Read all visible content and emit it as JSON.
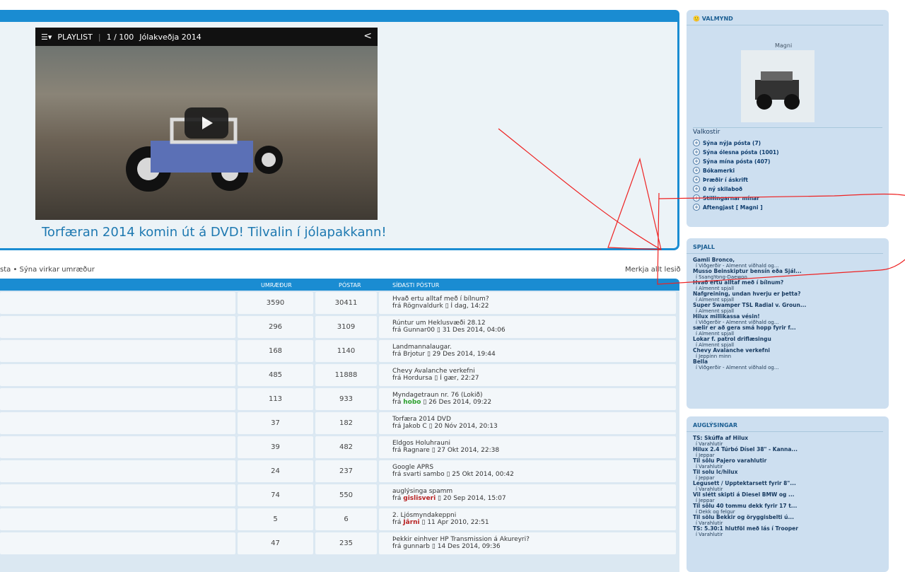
{
  "video": {
    "playlist_label": "PLAYLIST",
    "playlist_count": "1 / 100",
    "video_title": "Jólakveðja 2014",
    "caption": "Torfæran 2014 komin út á DVD! Tilvalin í jólapakkann!"
  },
  "crumbs": {
    "left": "sta • Sýna virkar umræður",
    "right": "Merkja allt lesið"
  },
  "forum": {
    "columns": [
      "UMRÆÐUR",
      "PÓSTAR",
      "SÍÐASTI PÓSTUR"
    ],
    "rows": [
      {
        "topics": "3590",
        "posts": "30411",
        "title": "Hvað ertu alltaf með í bílnum?",
        "by": "Rögnvaldurk",
        "date": "Í dag, 14:22",
        "color": ""
      },
      {
        "topics": "296",
        "posts": "3109",
        "title": "Rúntur um Heklusvæði 28.12",
        "by": "Gunnar00",
        "date": "31 Des 2014, 04:06",
        "color": ""
      },
      {
        "topics": "168",
        "posts": "1140",
        "title": "Landmannalaugar.",
        "by": "Brjotur",
        "date": "29 Des 2014, 19:44",
        "color": ""
      },
      {
        "topics": "485",
        "posts": "11888",
        "title": "Chevy Avalanche verkefni",
        "by": "Hordursa",
        "date": "Í gær, 22:27",
        "color": ""
      },
      {
        "topics": "113",
        "posts": "933",
        "title": "Myndagetraun nr. 76 (Lokið)",
        "by": "hobo",
        "date": "26 Des 2014, 09:22",
        "color": "green"
      },
      {
        "topics": "37",
        "posts": "182",
        "title": "Torfæra 2014 DVD",
        "by": "Jakob C",
        "date": "20 Nóv 2014, 20:13",
        "color": ""
      },
      {
        "topics": "39",
        "posts": "482",
        "title": "Eldgos Holuhrauni",
        "by": "Ragnare",
        "date": "27 Okt 2014, 22:38",
        "color": ""
      },
      {
        "topics": "24",
        "posts": "237",
        "title": "Google APRS",
        "by": "svarti sambo",
        "date": "25 Okt 2014, 00:42",
        "color": ""
      },
      {
        "topics": "74",
        "posts": "550",
        "title": "auglýsinga spamm",
        "by": "gislisveri",
        "date": "20 Sep 2014, 15:07",
        "color": "red"
      },
      {
        "topics": "5",
        "posts": "6",
        "title": "2. Ljósmyndakeppni",
        "by": "Jârni",
        "date": "11 Apr 2010, 22:51",
        "color": "red"
      },
      {
        "topics": "47",
        "posts": "235",
        "title": "Þekkir einhver HP Transmission á Akureyri?",
        "by": "gunnarb",
        "date": "14 Des 2014, 09:36",
        "color": ""
      }
    ],
    "from_prefix": "frá"
  },
  "valmynd": {
    "title": "VALMYND",
    "user": "Magni",
    "options_title": "Valkostir",
    "options": [
      "Sýna nýja pósta (7)",
      "Sýna ólesna pósta (1001)",
      "Sýna mína pósta (407)",
      "Bókamerki",
      "Þræðir í áskrift",
      "0 ný skilaboð",
      "Stillingarnar mínar",
      "Aftengjast [ Magni ]"
    ]
  },
  "spjall": {
    "title": "SPJALL",
    "posts": [
      [
        "Gamli Bronco,",
        "í Viðgerðir - Almennt viðhald og..."
      ],
      [
        "Musso Beinskiptur bensín eða Sjál...",
        "í SsangYong-Daewoo"
      ],
      [
        "Hvað ertu alltaf með í bílnum?",
        "í Almennt spjall"
      ],
      [
        "Nafgreining, undan hverju er þetta?",
        "í Almennt spjall"
      ],
      [
        "Super Swamper TSL Radial v. Groun...",
        "í Almennt spjall"
      ],
      [
        "Hilux millikassa vésin!",
        "í Viðgerðir - Almennt viðhald og..."
      ],
      [
        "sælir er að gera smá hopp fyrir f...",
        "í Almennt spjall"
      ],
      [
        "Lokar f. patrol driflæsingu",
        "í Almennt spjall"
      ],
      [
        "Chevy Avalanche verkefni",
        "í Jeppinn minn"
      ],
      [
        "Bella",
        "í Viðgerðir - Almennt viðhald og..."
      ]
    ]
  },
  "auglysingar": {
    "title": "AUGLÝSINGAR",
    "posts": [
      [
        "TS: Skúffa af Hilux",
        "í Varahlutir"
      ],
      [
        "Hilux 2.4 Túrbó Dísel 38\" - Kanna...",
        "í Jeppar"
      ],
      [
        "Til sölu Pajero varahlutir",
        "í Varahlutir"
      ],
      [
        "Til solu lc/hilux",
        "í Jeppar"
      ],
      [
        "Legusett / Upptektarsett fyrir 8\"...",
        "í Varahlutir"
      ],
      [
        "Vil slétt skipti á Diesel BMW og ...",
        "í Jeppar"
      ],
      [
        "Til sölu 40 tommu dekk fyrir 17 t...",
        "í Dekk og felgur"
      ],
      [
        "Til sölu Bekkir og öryggisbelti ú...",
        "í Varahlutir"
      ],
      [
        "TS: 5.30:1 hlutföl með lás í Trooper",
        "í Varahlutir"
      ]
    ]
  }
}
